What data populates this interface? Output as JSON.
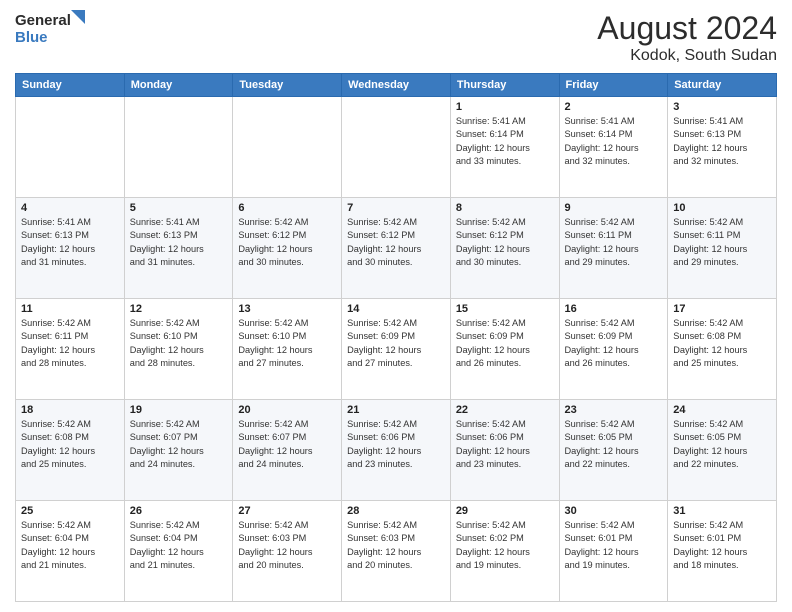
{
  "header": {
    "logo_line1": "General",
    "logo_line2": "Blue",
    "month": "August 2024",
    "location": "Kodok, South Sudan"
  },
  "days_of_week": [
    "Sunday",
    "Monday",
    "Tuesday",
    "Wednesday",
    "Thursday",
    "Friday",
    "Saturday"
  ],
  "weeks": [
    [
      {
        "day": "",
        "info": ""
      },
      {
        "day": "",
        "info": ""
      },
      {
        "day": "",
        "info": ""
      },
      {
        "day": "",
        "info": ""
      },
      {
        "day": "1",
        "info": "Sunrise: 5:41 AM\nSunset: 6:14 PM\nDaylight: 12 hours\nand 33 minutes."
      },
      {
        "day": "2",
        "info": "Sunrise: 5:41 AM\nSunset: 6:14 PM\nDaylight: 12 hours\nand 32 minutes."
      },
      {
        "day": "3",
        "info": "Sunrise: 5:41 AM\nSunset: 6:13 PM\nDaylight: 12 hours\nand 32 minutes."
      }
    ],
    [
      {
        "day": "4",
        "info": "Sunrise: 5:41 AM\nSunset: 6:13 PM\nDaylight: 12 hours\nand 31 minutes."
      },
      {
        "day": "5",
        "info": "Sunrise: 5:41 AM\nSunset: 6:13 PM\nDaylight: 12 hours\nand 31 minutes."
      },
      {
        "day": "6",
        "info": "Sunrise: 5:42 AM\nSunset: 6:12 PM\nDaylight: 12 hours\nand 30 minutes."
      },
      {
        "day": "7",
        "info": "Sunrise: 5:42 AM\nSunset: 6:12 PM\nDaylight: 12 hours\nand 30 minutes."
      },
      {
        "day": "8",
        "info": "Sunrise: 5:42 AM\nSunset: 6:12 PM\nDaylight: 12 hours\nand 30 minutes."
      },
      {
        "day": "9",
        "info": "Sunrise: 5:42 AM\nSunset: 6:11 PM\nDaylight: 12 hours\nand 29 minutes."
      },
      {
        "day": "10",
        "info": "Sunrise: 5:42 AM\nSunset: 6:11 PM\nDaylight: 12 hours\nand 29 minutes."
      }
    ],
    [
      {
        "day": "11",
        "info": "Sunrise: 5:42 AM\nSunset: 6:11 PM\nDaylight: 12 hours\nand 28 minutes."
      },
      {
        "day": "12",
        "info": "Sunrise: 5:42 AM\nSunset: 6:10 PM\nDaylight: 12 hours\nand 28 minutes."
      },
      {
        "day": "13",
        "info": "Sunrise: 5:42 AM\nSunset: 6:10 PM\nDaylight: 12 hours\nand 27 minutes."
      },
      {
        "day": "14",
        "info": "Sunrise: 5:42 AM\nSunset: 6:09 PM\nDaylight: 12 hours\nand 27 minutes."
      },
      {
        "day": "15",
        "info": "Sunrise: 5:42 AM\nSunset: 6:09 PM\nDaylight: 12 hours\nand 26 minutes."
      },
      {
        "day": "16",
        "info": "Sunrise: 5:42 AM\nSunset: 6:09 PM\nDaylight: 12 hours\nand 26 minutes."
      },
      {
        "day": "17",
        "info": "Sunrise: 5:42 AM\nSunset: 6:08 PM\nDaylight: 12 hours\nand 25 minutes."
      }
    ],
    [
      {
        "day": "18",
        "info": "Sunrise: 5:42 AM\nSunset: 6:08 PM\nDaylight: 12 hours\nand 25 minutes."
      },
      {
        "day": "19",
        "info": "Sunrise: 5:42 AM\nSunset: 6:07 PM\nDaylight: 12 hours\nand 24 minutes."
      },
      {
        "day": "20",
        "info": "Sunrise: 5:42 AM\nSunset: 6:07 PM\nDaylight: 12 hours\nand 24 minutes."
      },
      {
        "day": "21",
        "info": "Sunrise: 5:42 AM\nSunset: 6:06 PM\nDaylight: 12 hours\nand 23 minutes."
      },
      {
        "day": "22",
        "info": "Sunrise: 5:42 AM\nSunset: 6:06 PM\nDaylight: 12 hours\nand 23 minutes."
      },
      {
        "day": "23",
        "info": "Sunrise: 5:42 AM\nSunset: 6:05 PM\nDaylight: 12 hours\nand 22 minutes."
      },
      {
        "day": "24",
        "info": "Sunrise: 5:42 AM\nSunset: 6:05 PM\nDaylight: 12 hours\nand 22 minutes."
      }
    ],
    [
      {
        "day": "25",
        "info": "Sunrise: 5:42 AM\nSunset: 6:04 PM\nDaylight: 12 hours\nand 21 minutes."
      },
      {
        "day": "26",
        "info": "Sunrise: 5:42 AM\nSunset: 6:04 PM\nDaylight: 12 hours\nand 21 minutes."
      },
      {
        "day": "27",
        "info": "Sunrise: 5:42 AM\nSunset: 6:03 PM\nDaylight: 12 hours\nand 20 minutes."
      },
      {
        "day": "28",
        "info": "Sunrise: 5:42 AM\nSunset: 6:03 PM\nDaylight: 12 hours\nand 20 minutes."
      },
      {
        "day": "29",
        "info": "Sunrise: 5:42 AM\nSunset: 6:02 PM\nDaylight: 12 hours\nand 19 minutes."
      },
      {
        "day": "30",
        "info": "Sunrise: 5:42 AM\nSunset: 6:01 PM\nDaylight: 12 hours\nand 19 minutes."
      },
      {
        "day": "31",
        "info": "Sunrise: 5:42 AM\nSunset: 6:01 PM\nDaylight: 12 hours\nand 18 minutes."
      }
    ]
  ]
}
